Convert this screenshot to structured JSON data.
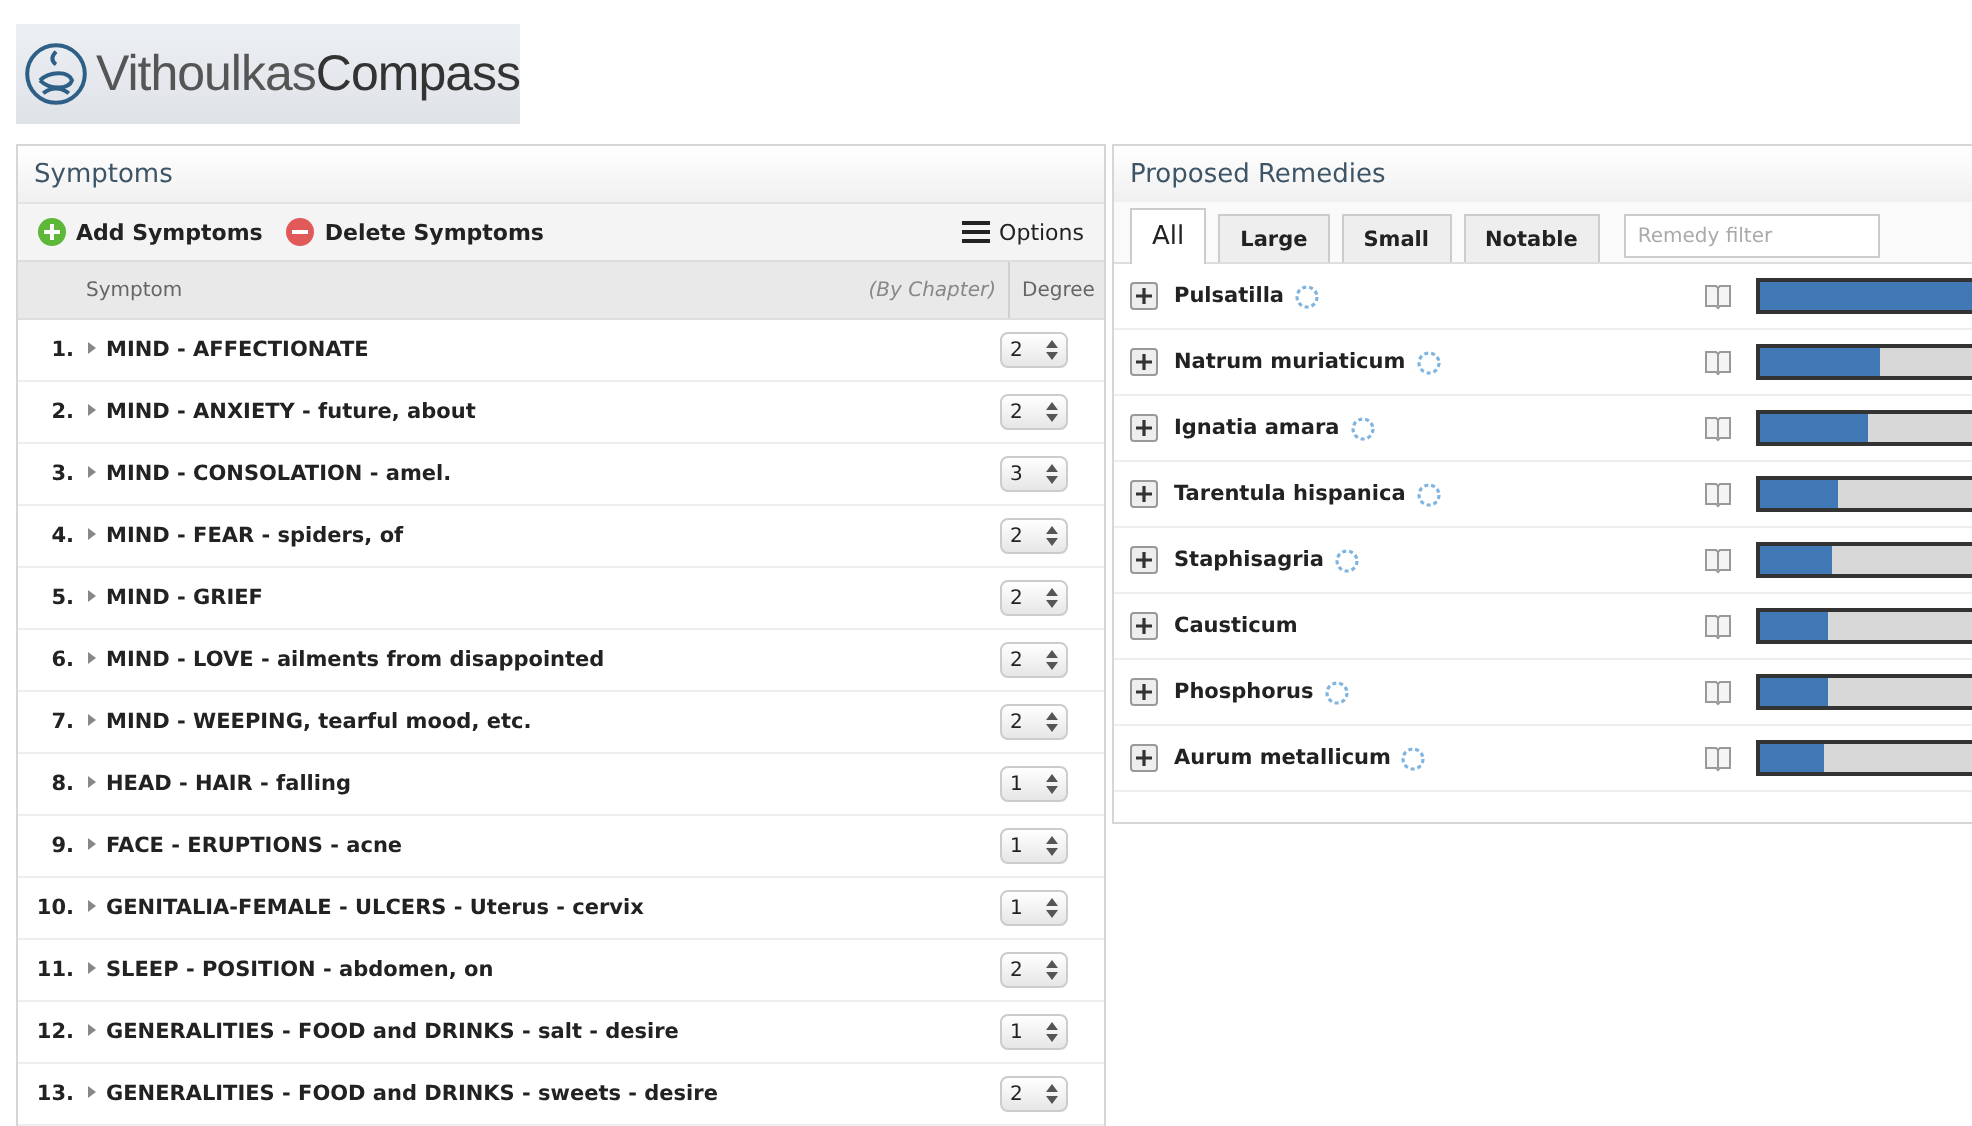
{
  "logo": {
    "name_light": "Vithoulkas",
    "name_bold": "Compass"
  },
  "symptoms": {
    "title": "Symptoms",
    "toolbar": {
      "add": "Add Symptoms",
      "delete": "Delete Symptoms",
      "options": "Options"
    },
    "columns": {
      "symptom": "Symptom",
      "chapter": "(By Chapter)",
      "degree": "Degree"
    },
    "rows": [
      {
        "number": "1.",
        "text": "MIND - AFFECTIONATE",
        "degree": "2"
      },
      {
        "number": "2.",
        "text": "MIND - ANXIETY - future, about",
        "degree": "2"
      },
      {
        "number": "3.",
        "text": "MIND - CONSOLATION - amel.",
        "degree": "3"
      },
      {
        "number": "4.",
        "text": "MIND - FEAR - spiders, of",
        "degree": "2"
      },
      {
        "number": "5.",
        "text": "MIND - GRIEF",
        "degree": "2"
      },
      {
        "number": "6.",
        "text": "MIND - LOVE - ailments from disappointed",
        "degree": "2"
      },
      {
        "number": "7.",
        "text": "MIND - WEEPING, tearful mood, etc.",
        "degree": "2"
      },
      {
        "number": "8.",
        "text": "HEAD - HAIR - falling",
        "degree": "1"
      },
      {
        "number": "9.",
        "text": "FACE - ERUPTIONS - acne",
        "degree": "1"
      },
      {
        "number": "10.",
        "text": "GENITALIA-FEMALE - ULCERS - Uterus - cervix",
        "degree": "1"
      },
      {
        "number": "11.",
        "text": "SLEEP - POSITION - abdomen, on",
        "degree": "2"
      },
      {
        "number": "12.",
        "text": "GENERALITIES - FOOD and DRINKS - salt - desire",
        "degree": "1"
      },
      {
        "number": "13.",
        "text": "GENERALITIES - FOOD and DRINKS - sweets - desire",
        "degree": "2"
      }
    ]
  },
  "remedies": {
    "title": "Proposed Remedies",
    "tabs": [
      {
        "label": "All",
        "selected": true
      },
      {
        "label": "Large",
        "selected": false
      },
      {
        "label": "Small",
        "selected": false
      },
      {
        "label": "Notable",
        "selected": false
      }
    ],
    "filter": {
      "placeholder": "Remedy filter"
    },
    "items": [
      {
        "name": "Pulsatilla",
        "indicator": true,
        "level": 1.0
      },
      {
        "name": "Natrum muriaticum",
        "indicator": true,
        "level": 0.57
      },
      {
        "name": "Ignatia amara",
        "indicator": true,
        "level": 0.51
      },
      {
        "name": "Tarentula hispanica",
        "indicator": true,
        "level": 0.37
      },
      {
        "name": "Staphisagria",
        "indicator": true,
        "level": 0.34
      },
      {
        "name": "Causticum",
        "indicator": false,
        "level": 0.32
      },
      {
        "name": "Phosphorus",
        "indicator": true,
        "level": 0.32
      },
      {
        "name": "Aurum metallicum",
        "indicator": true,
        "level": 0.3
      }
    ]
  }
}
